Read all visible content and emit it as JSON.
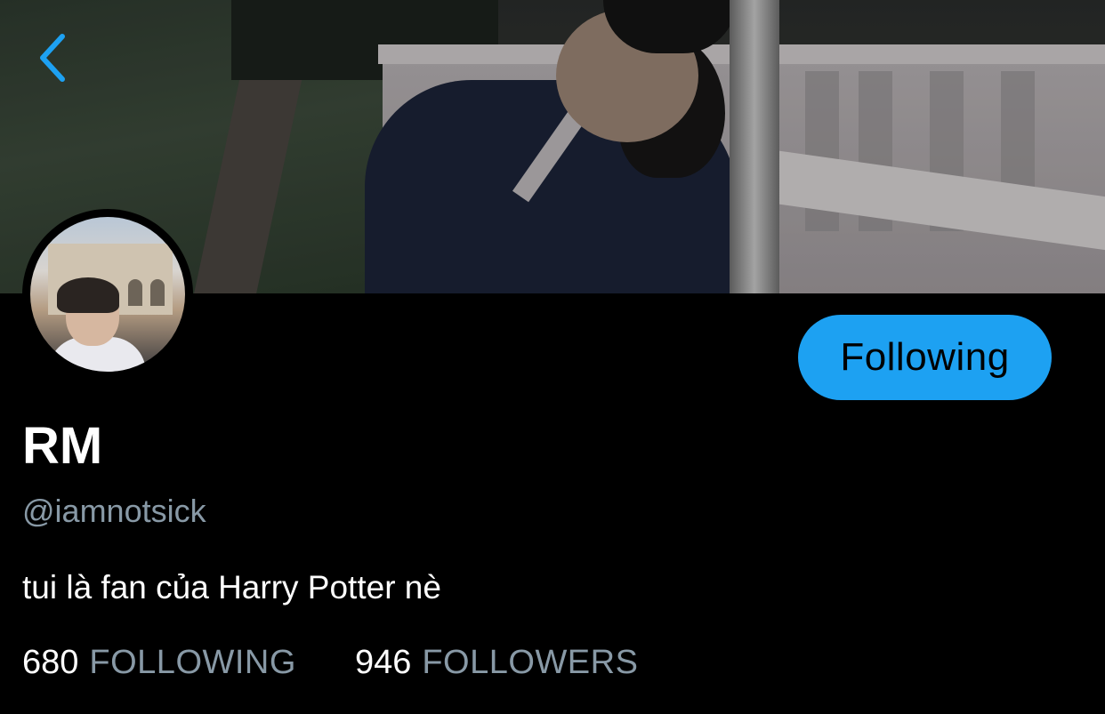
{
  "profile": {
    "display_name": "RM",
    "handle": "@iamnotsick",
    "bio": "tui là fan của Harry Potter nè"
  },
  "follow_button": {
    "label": "Following"
  },
  "stats": {
    "following_count": "680",
    "following_label": "FOLLOWING",
    "followers_count": "946",
    "followers_label": "FOLLOWERS"
  },
  "icons": {
    "back": "chevron-left-icon"
  },
  "colors": {
    "background": "#000000",
    "accent": "#1da1f2",
    "secondary_text": "#8899a6",
    "primary_text": "#ffffff"
  }
}
